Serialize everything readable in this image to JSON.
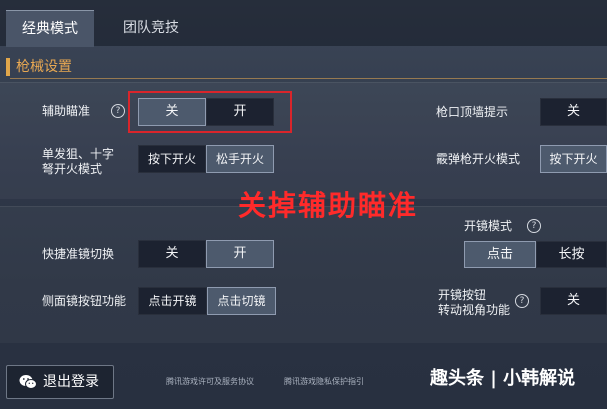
{
  "tabs": [
    {
      "label": "经典模式",
      "active": true
    },
    {
      "label": "团队竞技",
      "active": false
    }
  ],
  "section": {
    "title": "枪械设置"
  },
  "settings": {
    "aim_assist": {
      "label": "辅助瞄准",
      "help": "?",
      "options": [
        "关",
        "开"
      ],
      "selected": "关"
    },
    "muzzle_hint": {
      "label": "枪口顶墙提示",
      "options": [
        "关"
      ],
      "selected": "关"
    },
    "single_fire": {
      "label_line1": "单发狙、十字",
      "label_line2": "弩开火模式",
      "options": [
        "按下开火",
        "松手开火"
      ],
      "selected": "松手开火"
    },
    "shotgun_fire": {
      "label": "霰弹枪开火模式",
      "options": [
        "按下开火"
      ],
      "selected": "按下开火"
    },
    "quick_scope": {
      "label": "快捷准镜切换",
      "options": [
        "关",
        "开"
      ],
      "selected": "开"
    },
    "scope_mode": {
      "label": "开镜模式",
      "help": "?",
      "options": [
        "点击",
        "长按"
      ],
      "selected": "点击"
    },
    "side_scope": {
      "label": "侧面镜按钮功能",
      "options": [
        "点击开镜",
        "点击切镜"
      ],
      "selected": "点击切镜"
    },
    "scope_rotate": {
      "label_line1": "开镜按钮",
      "label_line2": "转动视角功能",
      "help": "?",
      "options": [
        "关"
      ],
      "selected": "关"
    }
  },
  "overlay_caption": "关掉辅助瞄准",
  "footer": {
    "logout_label": "退出登录",
    "logout_icon": "wechat-icon",
    "link1": "腾讯游戏许可及服务协议",
    "link2": "腾讯游戏隐私保护指引",
    "watermark": "趣头条 | 小韩解说"
  },
  "colors": {
    "accent": "#e8a852",
    "highlight": "#d9252b",
    "selected": "#4d5a6d"
  }
}
